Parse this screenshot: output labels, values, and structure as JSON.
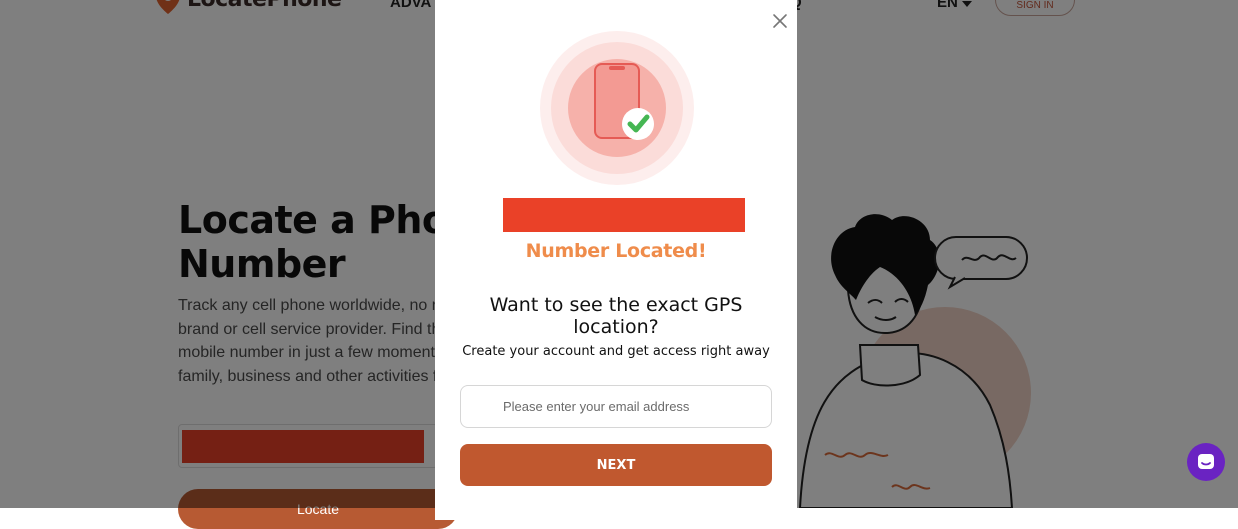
{
  "header": {
    "logo_text": "LocatePhone",
    "nav_left_text": "ADVA",
    "nav_right_text": "Q",
    "language": "EN",
    "signin_label": "SIGN IN"
  },
  "hero": {
    "title_line1": "Locate a Phon",
    "title_line2": "Number",
    "description_lines": [
      "Track any cell phone worldwide, no m",
      "brand or cell service provider. Find the",
      "mobile number in just a few moments",
      "family, business and other activities fo"
    ],
    "button_label": "Locate"
  },
  "modal": {
    "status_text": "Number Located!",
    "question": "Want to see the exact GPS location?",
    "subline": "Create your account and get access right away",
    "email_placeholder": "Please enter your email address",
    "email_value": "",
    "next_label": "NEXT"
  },
  "illustration": {
    "speech_text": "ooo"
  },
  "icons": {
    "logo": "location-pin-icon",
    "close": "close-icon",
    "phone": "smartphone-icon",
    "check": "check-circle-icon",
    "chat": "chat-icon",
    "language_caret": "caret-down-icon"
  },
  "colors": {
    "accent": "#c0582f",
    "located_orange": "#ef8c4b",
    "redaction_red": "#ea4128",
    "check_green": "#45b653",
    "chat_purple": "#6a23c2"
  }
}
